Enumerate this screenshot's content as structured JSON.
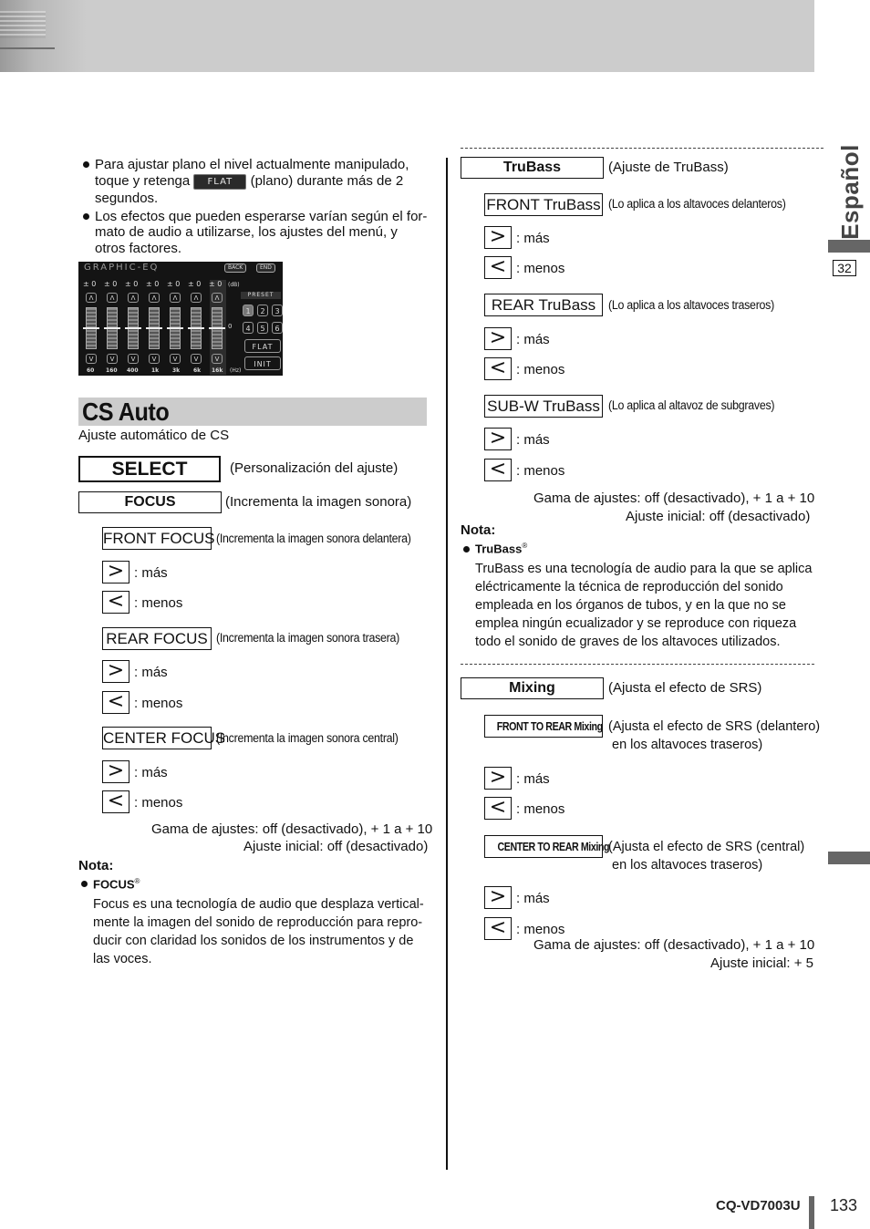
{
  "side": {
    "language": "Español",
    "section_number": "32"
  },
  "footer": {
    "model": "CQ-VD7003U",
    "page_number": "133"
  },
  "left": {
    "bullets": [
      {
        "line1": "Para ajustar plano el nivel actualmente manipulado,",
        "line2_pre": "toque y retenga",
        "button": "FLAT",
        "line2_post": "(plano) durante más de 2",
        "line3": "segundos."
      },
      {
        "line1": "Los efectos que pueden esperarse varían según el for-",
        "line2": "mato de audio a utilizarse, los ajustes del menú, y",
        "line3": "otros factores."
      }
    ],
    "eq_screen": {
      "title": "GRAPHIC-EQ",
      "back": "BACK",
      "end": "END",
      "values": [
        "± 0",
        "± 0",
        "± 0",
        "± 0",
        "± 0",
        "± 0",
        "± 0"
      ],
      "db_unit": "(dB)",
      "frequencies": [
        "60",
        "160",
        "400",
        "1k",
        "3k",
        "6k",
        "16k"
      ],
      "hz_unit": "(Hz)",
      "up_label": "Λ",
      "down_label": "V",
      "zero_label": "0",
      "preset_label": "PRESET",
      "presets": [
        "1",
        "2",
        "3",
        "4",
        "5",
        "6"
      ],
      "flat": "FLAT",
      "init": "INIT"
    },
    "section_title": "CS Auto",
    "section_subtitle": "Ajuste automático de CS",
    "select": {
      "label": "SELECT",
      "desc": "(Personalización del ajuste)"
    },
    "focus": {
      "label": "FOCUS",
      "desc": "(Incrementa la imagen sonora)"
    },
    "items": [
      {
        "label": "FRONT FOCUS",
        "desc": "(Incrementa la imagen sonora delantera)",
        "more": ": más",
        "less": ": menos"
      },
      {
        "label": "REAR FOCUS",
        "desc": "(Incrementa la imagen sonora trasera)",
        "more": ": más",
        "less": ": menos"
      },
      {
        "label": "CENTER FOCUS",
        "desc": "(Incrementa la imagen sonora central)",
        "more": ": más",
        "less": ": menos"
      }
    ],
    "range": "Gama de ajustes: off (desactivado), + 1 a + 10",
    "initial": "Ajuste inicial: off (desactivado)",
    "note_title": "Nota:",
    "note_item": "FOCUS",
    "note_reg": "®",
    "note_lines": [
      "Focus es una tecnología de audio que desplaza vertical-",
      "mente la imagen del sonido de reproducción para repro-",
      "ducir con claridad los sonidos de los instrumentos y de",
      "las voces."
    ]
  },
  "right": {
    "trubass": {
      "label": "TruBass",
      "desc": "(Ajuste de TruBass)"
    },
    "trubass_items": [
      {
        "label": "FRONT TruBass",
        "desc": "(Lo aplica a los altavoces delanteros)",
        "more": ": más",
        "less": ": menos"
      },
      {
        "label": "REAR TruBass",
        "desc": "(Lo aplica a los altavoces traseros)",
        "more": ": más",
        "less": ": menos"
      },
      {
        "label": "SUB-W TruBass",
        "desc": "(Lo aplica al altavoz de subgraves)",
        "more": ": más",
        "less": ": menos"
      }
    ],
    "trubass_range": "Gama de ajustes: off (desactivado), + 1 a + 10",
    "trubass_initial": "Ajuste inicial: off (desactivado)",
    "note_title": "Nota:",
    "note_item": "TruBass",
    "note_reg": "®",
    "note_lines": [
      "TruBass es una tecnología de audio para la que se aplica",
      "eléctricamente la técnica de reproducción del sonido",
      "empleada en los órganos de tubos, y en la que no se",
      "emplea ningún ecualizador y se reproduce con riqueza",
      "todo el sonido de graves de los altavoces utilizados."
    ],
    "mixing": {
      "label": "Mixing",
      "desc": "(Ajusta el efecto de SRS)"
    },
    "mixing_items": [
      {
        "label": "FRONT TO REAR Mixing",
        "desc1": "(Ajusta el efecto de SRS (delantero)",
        "desc2": "en los altavoces traseros)",
        "more": ": más",
        "less": ": menos"
      },
      {
        "label": "CENTER TO REAR Mixing",
        "desc1": "(Ajusta el efecto de SRS (central)",
        "desc2": "en los altavoces traseros)",
        "more": ": más",
        "less": ": menos"
      }
    ],
    "mixing_range": "Gama de ajustes: off (desactivado), + 1 a + 10",
    "mixing_initial": "Ajuste inicial: + 5"
  },
  "icons": {
    "more": ">",
    "less": "<"
  }
}
